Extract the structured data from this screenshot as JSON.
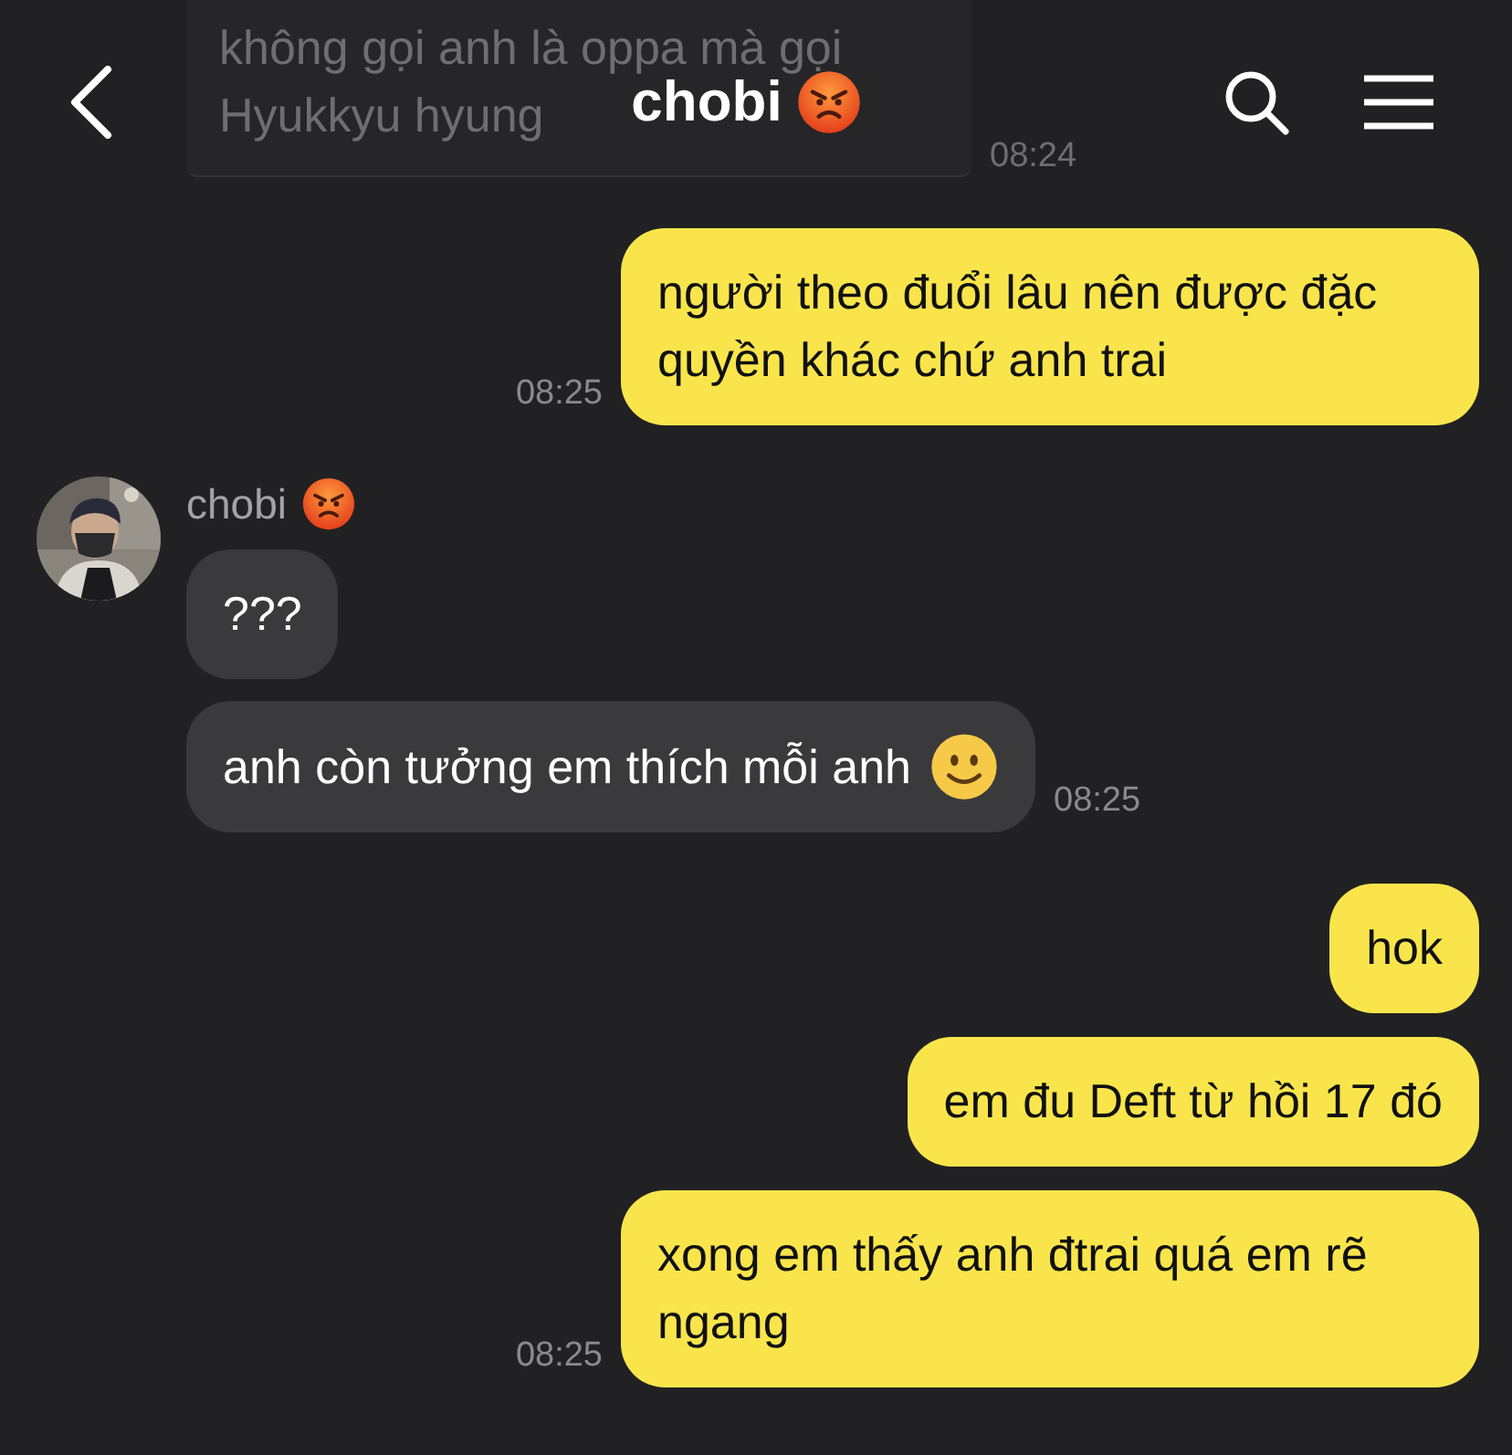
{
  "header": {
    "title": "chobi",
    "title_emoji": true
  },
  "messages": [
    {
      "kind": "received",
      "faded": true,
      "text": "không gọi anh là oppa mà gọi Hyukkyu hyung",
      "time": "08:24"
    },
    {
      "kind": "sent",
      "text": "người theo đuổi lâu nên được đặc quyền khác chứ anh trai",
      "time": "08:25"
    },
    {
      "kind": "received",
      "sender": "chobi",
      "sender_emoji": true,
      "text": "???"
    },
    {
      "kind": "received",
      "text": "anh còn tưởng em thích mỗi anh",
      "emoji": true,
      "time": "08:25"
    },
    {
      "kind": "sent",
      "text": "hok"
    },
    {
      "kind": "sent",
      "text": "em đu Deft từ hồi 17 đó"
    },
    {
      "kind": "sent",
      "text": "xong em thấy anh đtrai quá em rẽ ngang",
      "time": "08:25"
    }
  ]
}
